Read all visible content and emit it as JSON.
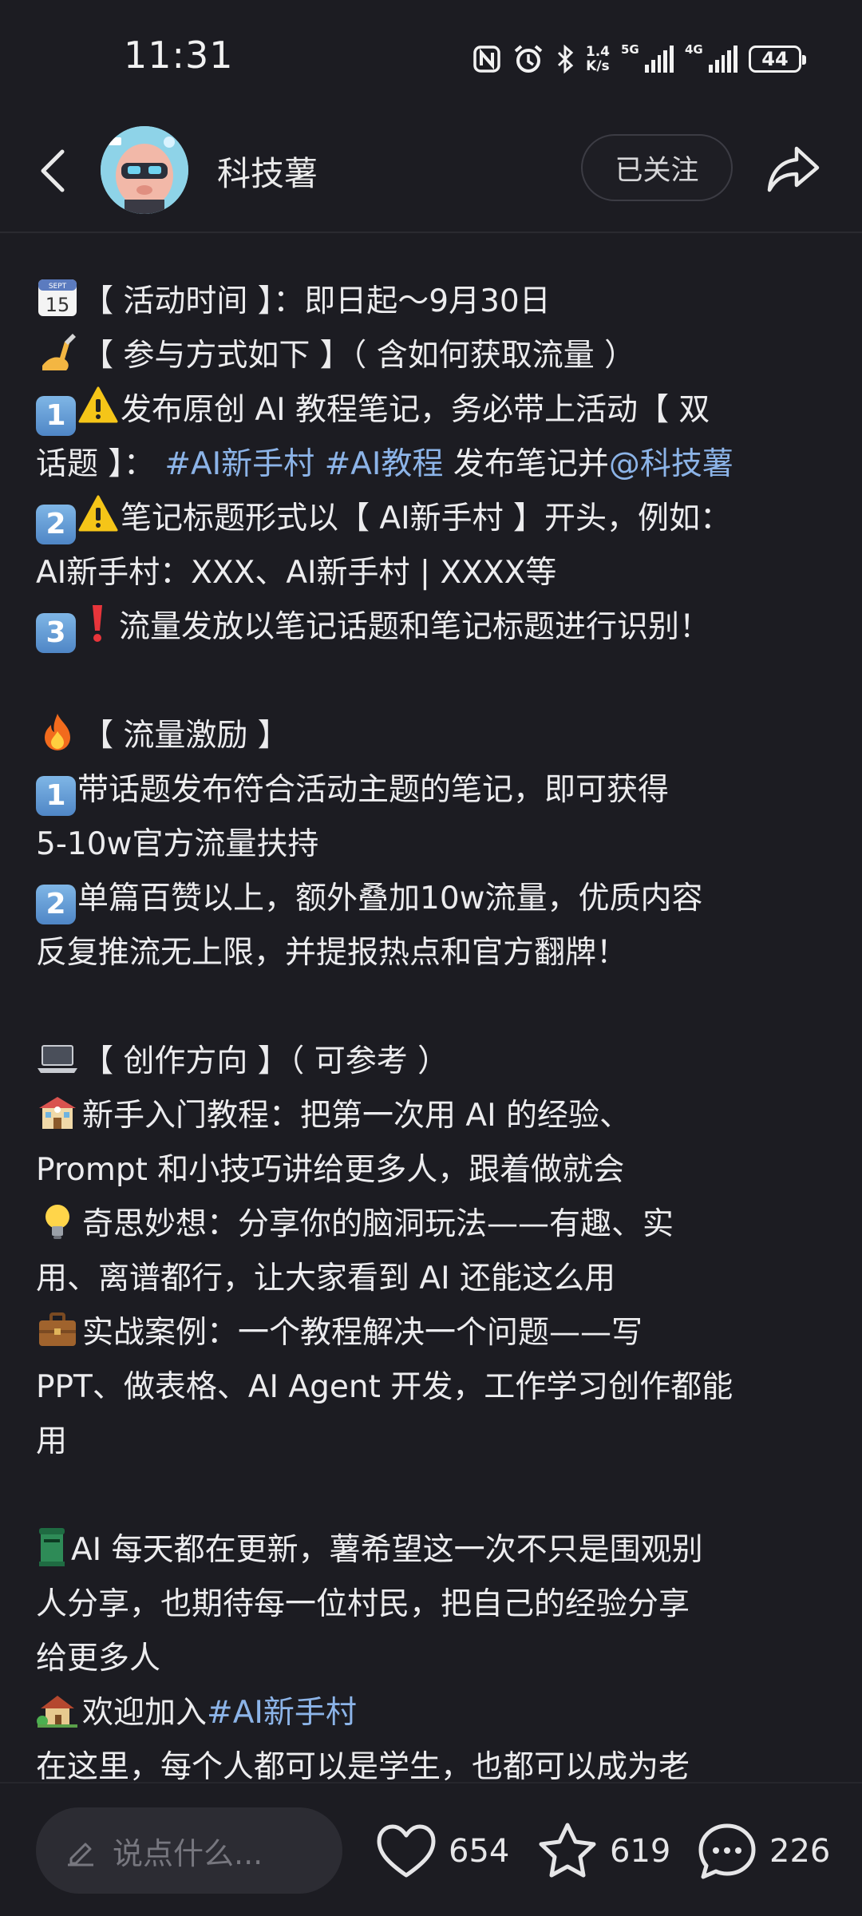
{
  "status_bar": {
    "time": "11:31",
    "net_speed_value": "1.4",
    "net_speed_unit": "K/s",
    "signal1": "5G",
    "signal2": "4G",
    "battery": "44"
  },
  "header": {
    "author": "科技薯",
    "follow_label": "已关注"
  },
  "content": {
    "l1": "【 活动时间 】：即日起～9月30日",
    "l2": "【 参与方式如下 】（ 含如何获取流量 ）",
    "l3": "发布原创 AI 教程笔记，务必带上活动【 双",
    "l4a": "话题 】：",
    "l4_tag1": "#AI新手村",
    "l4_tag2": "#AI教程",
    "l4b": "发布笔记并",
    "l4_mention": "@科技薯",
    "l5": "笔记标题形式以【 AI新手村 】开头，例如：",
    "l6": "AI新手村：XXX、AI新手村 | XXXX等",
    "l7": "流量发放以笔记话题和笔记标题进行识别！",
    "l8": "【 流量激励 】",
    "l9": "带话题发布符合活动主题的笔记，即可获得",
    "l10": "5-10w官方流量扶持",
    "l11": "单篇百赞以上，额外叠加10w流量，优质内容",
    "l12": "反复推流无上限，并提报热点和官方翻牌！",
    "l13": "【 创作方向 】（ 可参考 ）",
    "l14": "新手入门教程：把第一次用 AI 的经验、",
    "l15": "Prompt 和小技巧讲给更多人，跟着做就会",
    "l16": "奇思妙想：分享你的脑洞玩法——有趣、实",
    "l17": "用、离谱都行，让大家看到 AI 还能这么用",
    "l18": "实战案例：一个教程解决一个问题——写",
    "l19": "PPT、做表格、AI Agent 开发，工作学习创作都能",
    "l20": "用",
    "l21": "AI 每天都在更新，薯希望这一次不只是围观别",
    "l22": "人分享，也期待每一位村民，把自己的经验分享",
    "l23": "给更多人",
    "l24a": "欢迎加入",
    "l24_tag": "#AI新手村",
    "l25": "在这里，每个人都可以是学生，也都可以成为老",
    "calendar_month": "SEPT",
    "calendar_day": "15",
    "num1": "1",
    "num2": "2",
    "num3": "3"
  },
  "bottom_bar": {
    "comment_placeholder": "说点什么...",
    "likes": "654",
    "collects": "619",
    "comments": "226"
  },
  "colors": {
    "background": "#1c1c22",
    "hashtag": "#8cb4e8",
    "text": "#ececee"
  }
}
